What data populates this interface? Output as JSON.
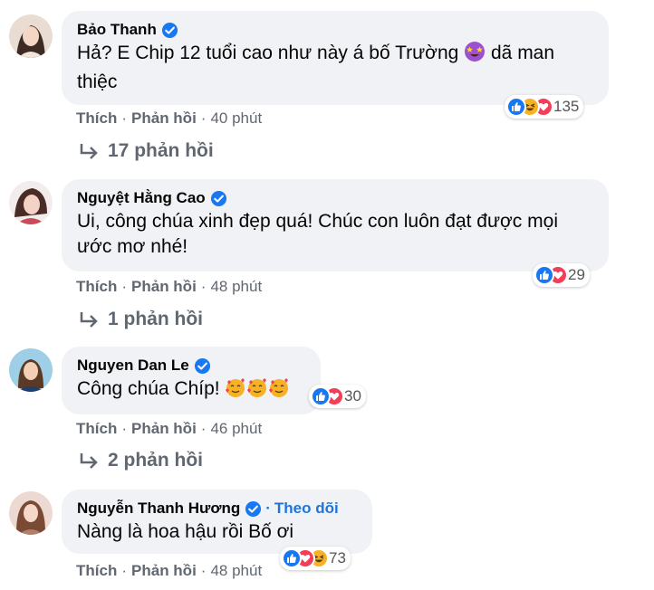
{
  "comments": [
    {
      "author": "Bảo Thanh",
      "text_parts": [
        "Hả? E Chip 12 tuổi cao như này á bố Trường",
        "dã man",
        "thiệc"
      ],
      "reaction_count": "135",
      "like_label": "Thích",
      "reply_label": "Phản hồi",
      "time": "40 phút",
      "replies": "17 phản hồi"
    },
    {
      "author": "Nguyệt Hằng Cao",
      "text_line1": "Ui, công chúa xinh đẹp quá! Chúc con luôn đạt được mọi",
      "text_line2": "ước mơ nhé!",
      "reaction_count": "29",
      "like_label": "Thích",
      "reply_label": "Phản hồi",
      "time": "48 phút",
      "replies": "1 phản hồi"
    },
    {
      "author": "Nguyen Dan Le",
      "text": "Công chúa Chíp!",
      "reaction_count": "30",
      "like_label": "Thích",
      "reply_label": "Phản hồi",
      "time": "46 phút",
      "replies": "2 phản hồi"
    },
    {
      "author": "Nguyễn Thanh Hương",
      "follow_label": "Theo dõi",
      "text": "Nàng là hoa hậu rồi Bố ơi",
      "reaction_count": "73",
      "like_label": "Thích",
      "reply_label": "Phản hồi",
      "time": "48 phút"
    }
  ],
  "colors": {
    "bubble": "#f0f2f5",
    "verified": "#1877f2",
    "link": "#2075d8",
    "meta": "#606770",
    "like": "#1877f2",
    "love": "#f33e58",
    "haha": "#f7b125"
  },
  "icons": [
    "verified-badge-icon",
    "like-reaction-icon",
    "love-reaction-icon",
    "haha-reaction-icon",
    "reply-arrow-icon",
    "star-struck-emoji",
    "smiling-hearts-emoji"
  ]
}
